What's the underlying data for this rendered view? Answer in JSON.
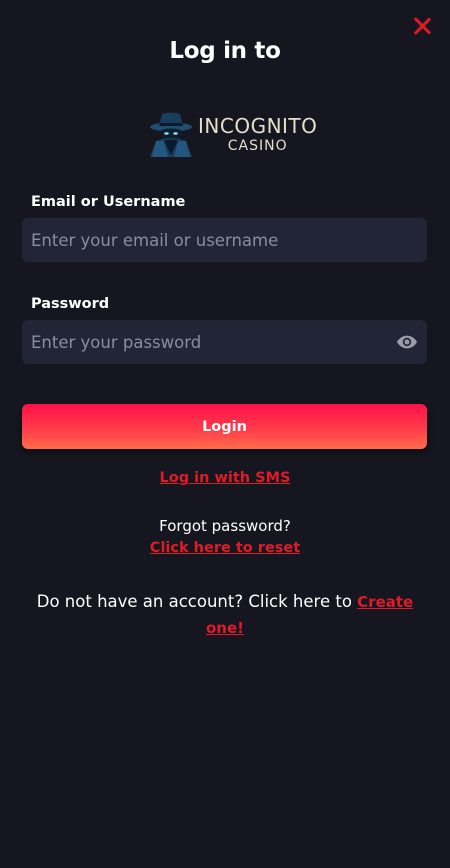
{
  "header": {
    "title": "Log in to"
  },
  "brand": {
    "logo_main": "INCOGNITO",
    "logo_sub": "CASINO",
    "accent_color": "#e11a28"
  },
  "form": {
    "email_label": "Email or Username",
    "email_placeholder": "Enter your email or username",
    "email_value": "",
    "password_label": "Password",
    "password_placeholder": "Enter your password",
    "password_value": "",
    "password_toggle_icon": "eye-icon",
    "login_label": "Login"
  },
  "links": {
    "sms": "Log in with SMS",
    "forgot_text": "Forgot password?",
    "reset": "Click here to reset",
    "no_account_text": "Do not have an account? Click here to",
    "create": "Create one!"
  },
  "icons": {
    "close": "close-icon"
  }
}
